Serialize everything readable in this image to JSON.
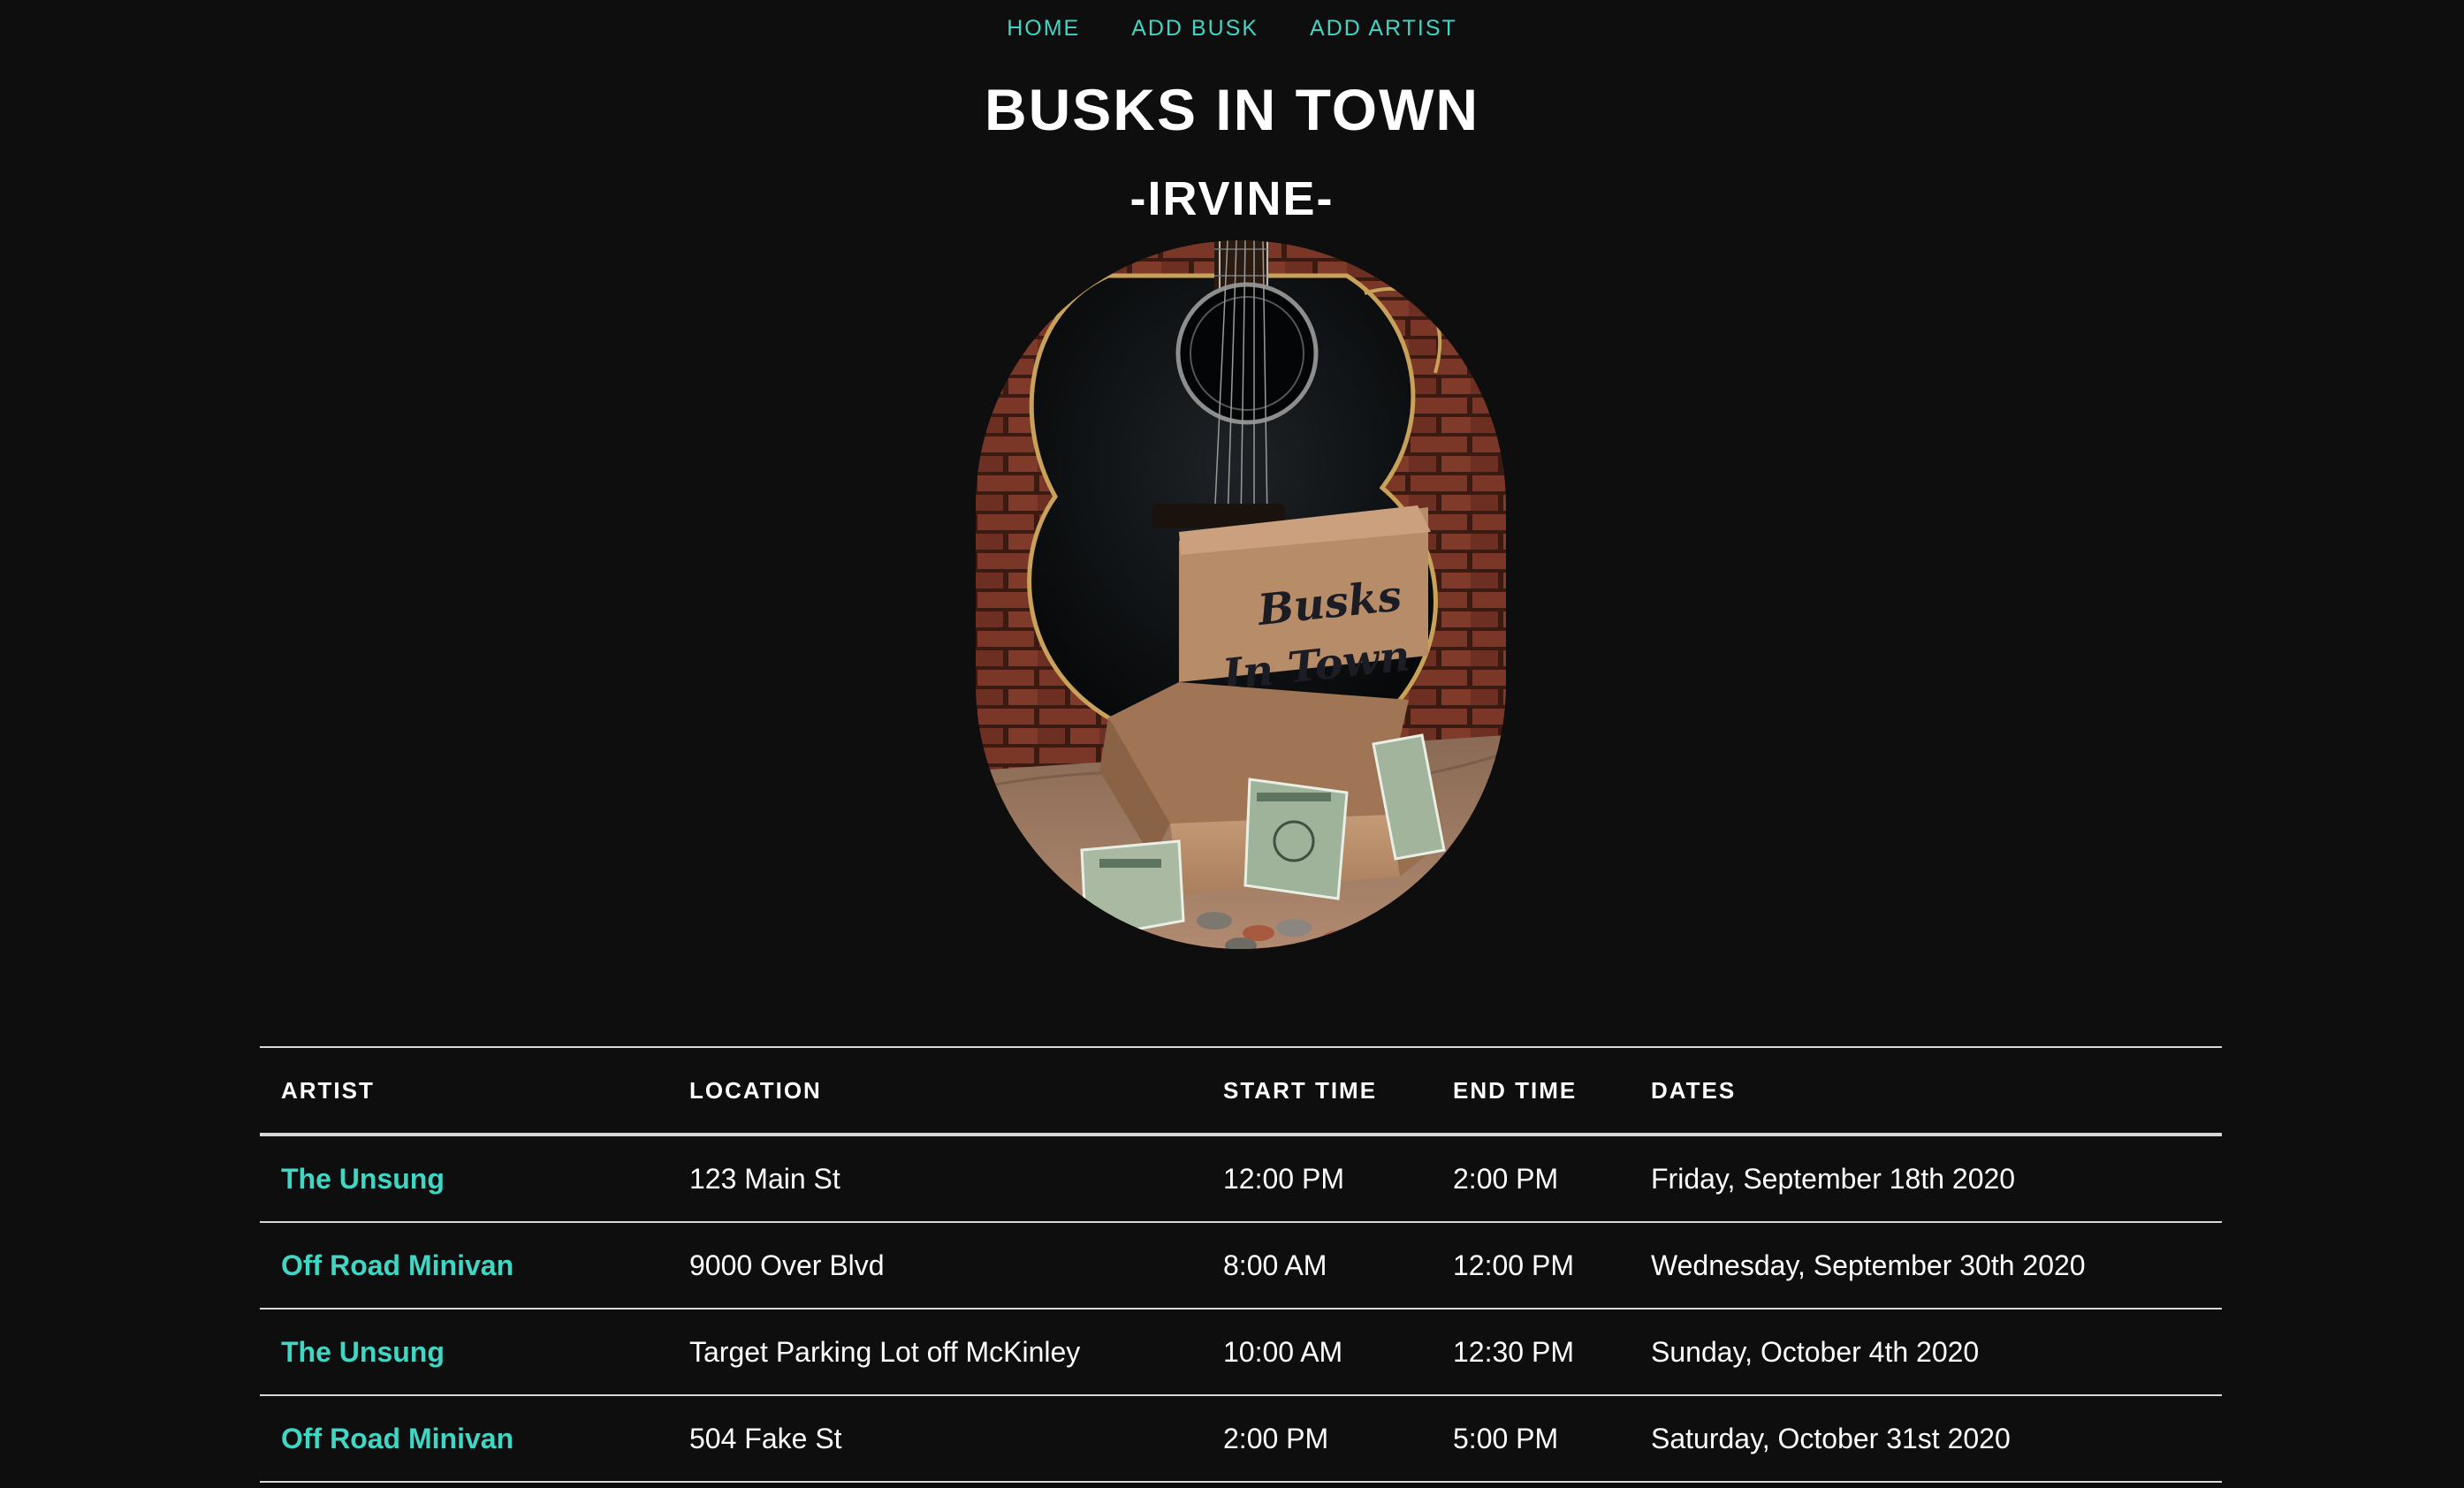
{
  "nav": {
    "items": [
      {
        "label": "HOME"
      },
      {
        "label": "ADD BUSK"
      },
      {
        "label": "ADD ARTIST"
      }
    ]
  },
  "header": {
    "title": "BUSKS IN TOWN",
    "city": "-IRVINE-"
  },
  "hero": {
    "box_lettering": "Busks In Town"
  },
  "table": {
    "columns": [
      "ARTIST",
      "LOCATION",
      "START TIME",
      "END TIME",
      "DATES"
    ],
    "rows": [
      {
        "artist": "The Unsung",
        "location": "123 Main St",
        "start": "12:00 PM",
        "end": "2:00 PM",
        "date": "Friday, September 18th 2020"
      },
      {
        "artist": "Off Road Minivan",
        "location": "9000 Over Blvd",
        "start": "8:00 AM",
        "end": "12:00 PM",
        "date": "Wednesday, September 30th 2020"
      },
      {
        "artist": "The Unsung",
        "location": "Target Parking Lot off McKinley",
        "start": "10:00 AM",
        "end": "12:30 PM",
        "date": "Sunday, October 4th 2020"
      },
      {
        "artist": "Off Road Minivan",
        "location": "504 Fake St",
        "start": "2:00 PM",
        "end": "5:00 PM",
        "date": "Saturday, October 31st 2020"
      }
    ]
  },
  "colors": {
    "background": "#0e0e0f",
    "accent": "#40d6c4",
    "text": "#ffffff",
    "rule": "#d8d8d8"
  }
}
